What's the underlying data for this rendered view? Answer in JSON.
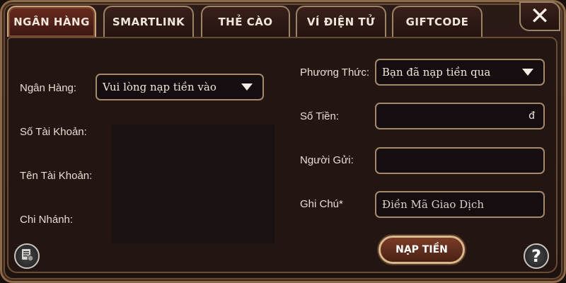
{
  "tabs": [
    {
      "label": "NGÂN HÀNG",
      "active": true
    },
    {
      "label": "SMARTLINK",
      "active": false
    },
    {
      "label": "THẺ CÀO",
      "active": false
    },
    {
      "label": "VÍ ĐIỆN TỬ",
      "active": false
    },
    {
      "label": "GIFTCODE",
      "active": false
    }
  ],
  "close_label": "✕",
  "left": {
    "bank_label": "Ngân Hàng:",
    "bank_select_value": "Vui lòng nạp tiền vào",
    "account_number_label": "Số Tài Khoản:",
    "account_name_label": "Tên Tài Khoản:",
    "branch_label": "Chi Nhánh:"
  },
  "right": {
    "method_label": "Phương Thức:",
    "method_select_value": "Bạn đã nạp tiền qua",
    "amount_label": "Số Tiền:",
    "amount_currency": "đ",
    "sender_label": "Người Gửi:",
    "note_label": "Ghi Chú*",
    "note_placeholder": "Điền Mã Giao Dịch"
  },
  "submit_label": "NẠP TIỀN",
  "help_label": "?",
  "icons": {
    "close": "close-icon",
    "history": "history-icon",
    "help": "help-icon",
    "dropdown": "chevron-down-icon"
  },
  "colors": {
    "active_tab": "#6a2a1f",
    "border": "#a4896a",
    "background": "#231512"
  }
}
